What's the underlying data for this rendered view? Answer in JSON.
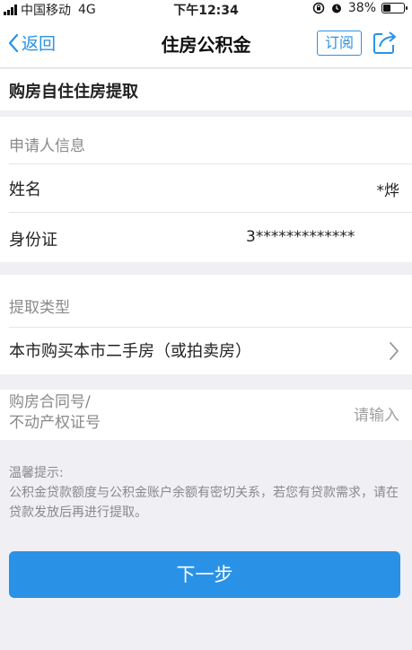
{
  "status": {
    "carrier": "中国移动",
    "network": "4G",
    "time": "下午12:34",
    "battery": "38%",
    "battery_level": 0.38
  },
  "nav": {
    "back_label": "返回",
    "title": "住房公积金",
    "subscribe_label": "订阅"
  },
  "page": {
    "heading": "购房自住住房提取"
  },
  "applicant": {
    "section_label": "申请人信息",
    "name_label": "姓名",
    "name_value": "*烨",
    "id_label": "身份证",
    "id_value": "3*************"
  },
  "withdraw": {
    "section_label": "提取类型",
    "type_value": "本市购买本市二手房（或拍卖房）"
  },
  "contract": {
    "label_line1": "购房合同号/",
    "label_line2": "不动产权证号",
    "placeholder": "请输入"
  },
  "tips": {
    "title": "温馨提示:",
    "body": "公积金贷款额度与公积金账户余额有密切关系，若您有贷款需求，请在贷款发放后再进行提取。"
  },
  "actions": {
    "next_label": "下一步"
  },
  "colors": {
    "accent": "#2a92e6",
    "background": "#efeff4"
  }
}
